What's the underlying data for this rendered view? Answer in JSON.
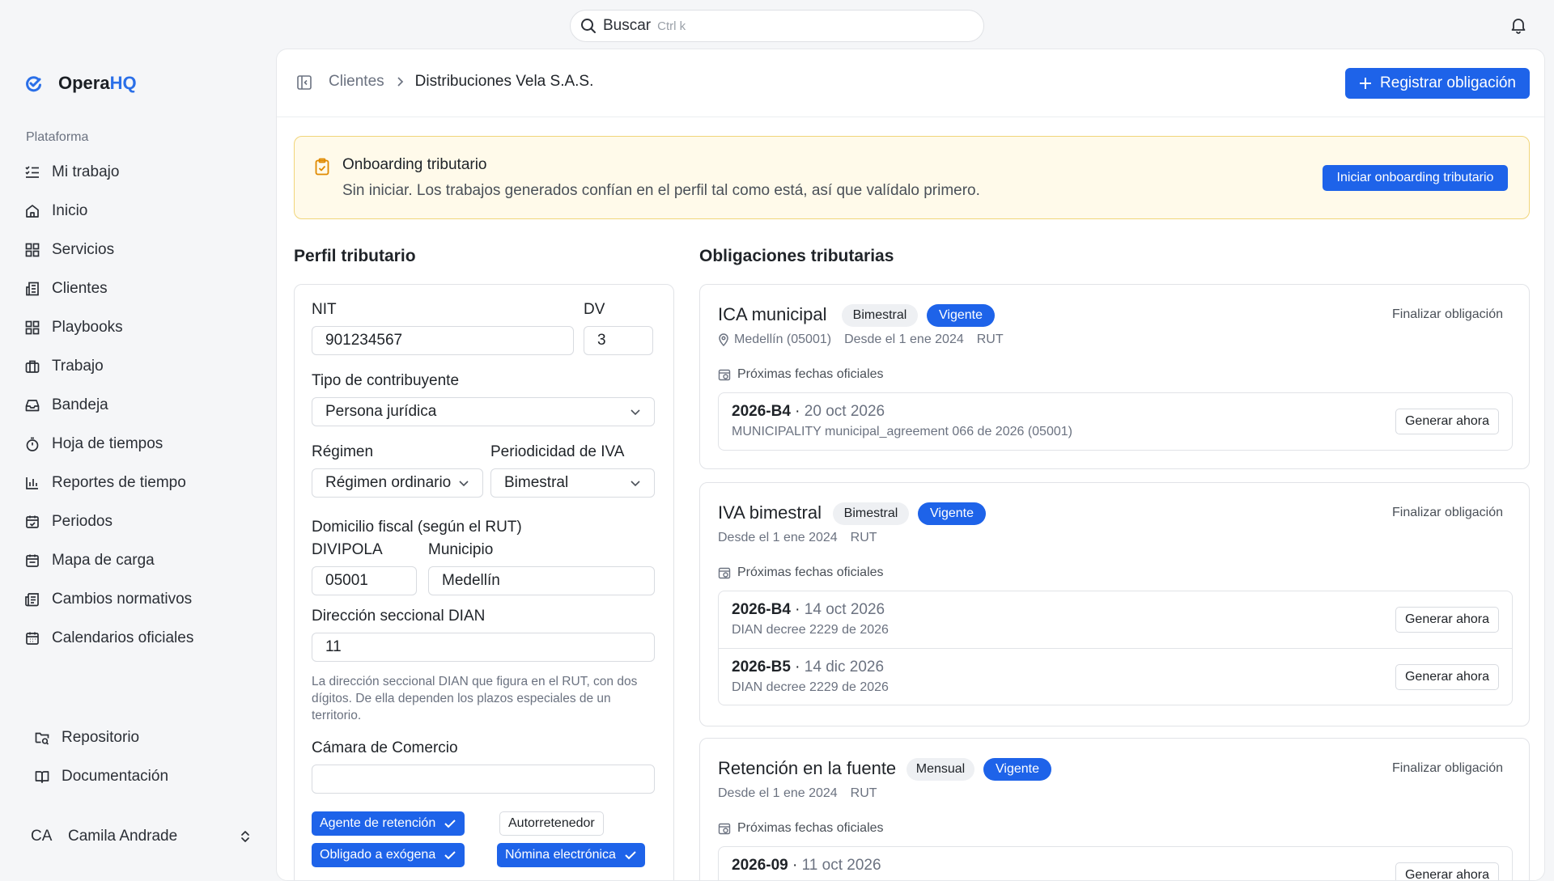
{
  "search": {
    "label": "Buscar",
    "shortcut": "Ctrl k"
  },
  "brand": {
    "name_part1": "Opera",
    "name_part2": "HQ"
  },
  "sidebar": {
    "section_label": "Plataforma",
    "items": [
      {
        "label": "Mi trabajo",
        "icon": "list-check-icon"
      },
      {
        "label": "Inicio",
        "icon": "home-icon"
      },
      {
        "label": "Servicios",
        "icon": "grid-icon"
      },
      {
        "label": "Clientes",
        "icon": "building-icon"
      },
      {
        "label": "Playbooks",
        "icon": "grid-icon"
      },
      {
        "label": "Trabajo",
        "icon": "briefcase-icon"
      },
      {
        "label": "Bandeja",
        "icon": "inbox-icon"
      },
      {
        "label": "Hoja de tiempos",
        "icon": "stopwatch-icon"
      },
      {
        "label": "Reportes de tiempo",
        "icon": "bar-chart-icon"
      },
      {
        "label": "Periodos",
        "icon": "calendar-check-icon"
      },
      {
        "label": "Mapa de carga",
        "icon": "calendar-icon"
      },
      {
        "label": "Cambios normativos",
        "icon": "newspaper-icon"
      },
      {
        "label": "Calendarios oficiales",
        "icon": "calendar-grid-icon"
      }
    ],
    "bottom_items": [
      {
        "label": "Repositorio",
        "icon": "folder-search-icon"
      },
      {
        "label": "Documentación",
        "icon": "book-icon"
      }
    ],
    "user": {
      "initials": "CA",
      "name": "Camila Andrade"
    }
  },
  "header": {
    "breadcrumb_parent": "Clientes",
    "breadcrumb_current": "Distribuciones Vela S.A.S.",
    "primary_button": "Registrar obligación"
  },
  "banner": {
    "title": "Onboarding tributario",
    "text": "Sin iniciar. Los trabajos generados confían en el perfil tal como está, así que valídalo primero.",
    "button": "Iniciar onboarding tributario"
  },
  "profile": {
    "heading": "Perfil tributario",
    "nit_label": "NIT",
    "nit_value": "901234567",
    "dv_label": "DV",
    "dv_value": "3",
    "tipo_label": "Tipo de contribuyente",
    "tipo_value": "Persona jurídica",
    "regimen_label": "Régimen",
    "regimen_value": "Régimen ordinario",
    "periodicidad_label": "Periodicidad de IVA",
    "periodicidad_value": "Bimestral",
    "domicilio_label": "Domicilio fiscal (según el RUT)",
    "divipola_label": "DIVIPOLA",
    "divipola_value": "05001",
    "municipio_label": "Municipio",
    "municipio_value": "Medellín",
    "seccional_label": "Dirección seccional DIAN",
    "seccional_value": "11",
    "seccional_help": "La dirección seccional DIAN que figura en el RUT, con dos dígitos. De ella dependen los plazos especiales de un territorio.",
    "camara_label": "Cámara de Comercio",
    "camara_value": "",
    "chips": [
      {
        "label": "Agente de retención",
        "selected": true
      },
      {
        "label": "Autorretenedor",
        "selected": false
      },
      {
        "label": "Obligado a exógena",
        "selected": true
      },
      {
        "label": "Nómina electrónica",
        "selected": true
      }
    ]
  },
  "obligations": {
    "heading": "Obligaciones tributarias",
    "finalize_label": "Finalizar obligación",
    "upcoming_label": "Próximas fechas oficiales",
    "generate_label": "Generar ahora",
    "items": [
      {
        "title": "ICA municipal",
        "frequency": "Bimestral",
        "status": "Vigente",
        "location": "Medellín (05001)",
        "since": "Desde el 1 ene 2024",
        "source": "RUT",
        "dates": [
          {
            "code": "2026-B4",
            "date": "20 oct 2026",
            "detail": "MUNICIPALITY municipal_agreement 066 de 2026 (05001)"
          }
        ]
      },
      {
        "title": "IVA bimestral",
        "frequency": "Bimestral",
        "status": "Vigente",
        "since": "Desde el 1 ene 2024",
        "source": "RUT",
        "dates": [
          {
            "code": "2026-B4",
            "date": "14 oct 2026",
            "detail": "DIAN decree 2229 de 2026"
          },
          {
            "code": "2026-B5",
            "date": "14 dic 2026",
            "detail": "DIAN decree 2229 de 2026"
          }
        ]
      },
      {
        "title": "Retención en la fuente",
        "frequency": "Mensual",
        "status": "Vigente",
        "since": "Desde el 1 ene 2024",
        "source": "RUT",
        "dates": [
          {
            "code": "2026-09",
            "date": "11 oct 2026",
            "detail": ""
          }
        ]
      }
    ]
  },
  "colors": {
    "accent": "#1e63e9",
    "banner_bg": "#fffaea",
    "banner_border": "#f1d57a"
  }
}
